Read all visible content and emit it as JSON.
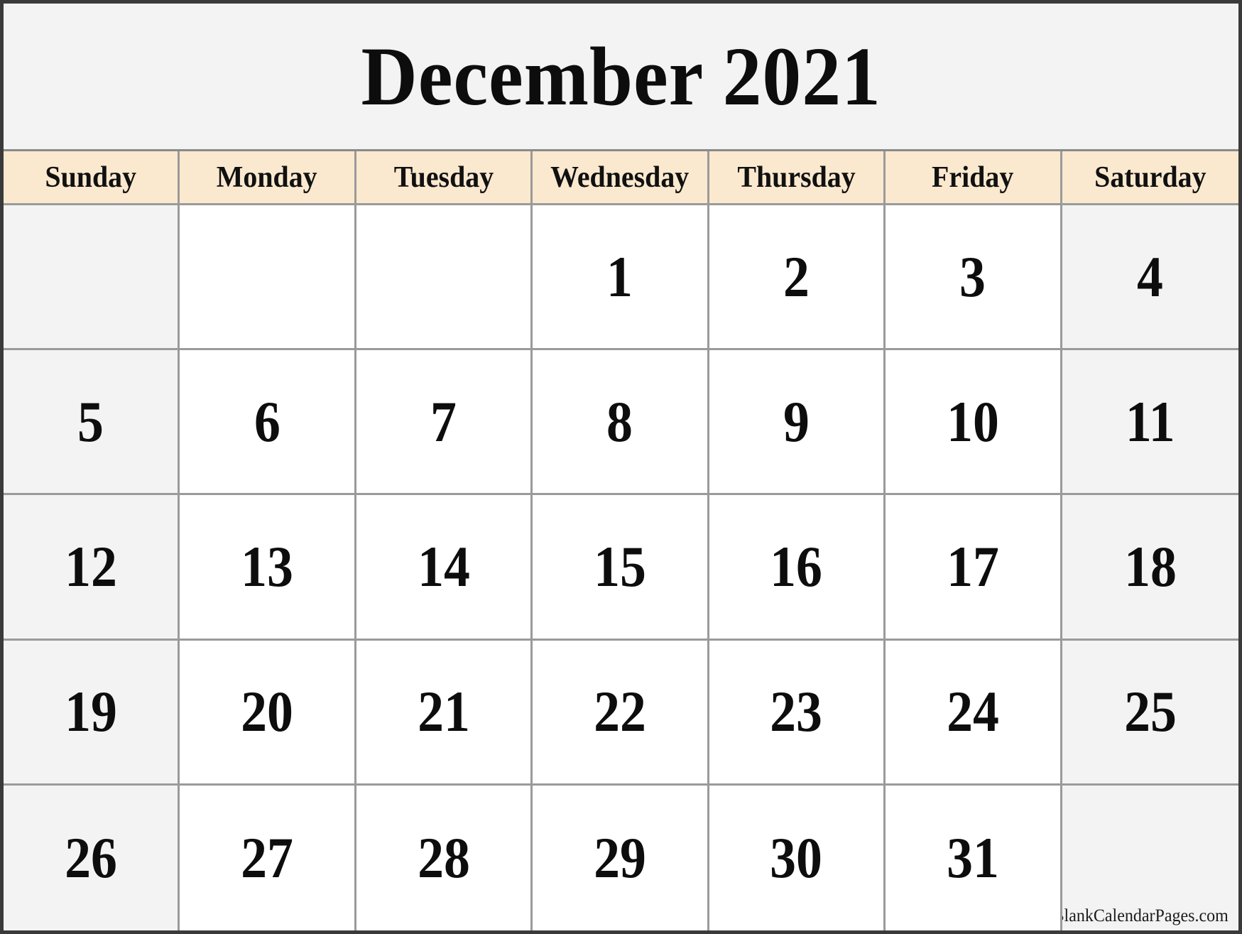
{
  "title": "December 2021",
  "month": "December",
  "year": "2021",
  "weekdays": [
    "Sunday",
    "Monday",
    "Tuesday",
    "Wednesday",
    "Thursday",
    "Friday",
    "Saturday"
  ],
  "weeks": [
    [
      "",
      "",
      "",
      "1",
      "2",
      "3",
      "4"
    ],
    [
      "5",
      "6",
      "7",
      "8",
      "9",
      "10",
      "11"
    ],
    [
      "12",
      "13",
      "14",
      "15",
      "16",
      "17",
      "18"
    ],
    [
      "19",
      "20",
      "21",
      "22",
      "23",
      "24",
      "25"
    ],
    [
      "26",
      "27",
      "28",
      "29",
      "30",
      "31",
      ""
    ]
  ],
  "credit": "© BlankCalendarPages.com",
  "colors": {
    "outer_border": "#3a3a3a",
    "grid_line": "#9a9a9a",
    "weekday_header_bg": "#fbe9cf",
    "weekend_cell_bg": "#f2f3f2",
    "weekday_cell_bg": "#ffffff",
    "title_bg": "#f3f3f3",
    "text": "#0d0d0d"
  }
}
